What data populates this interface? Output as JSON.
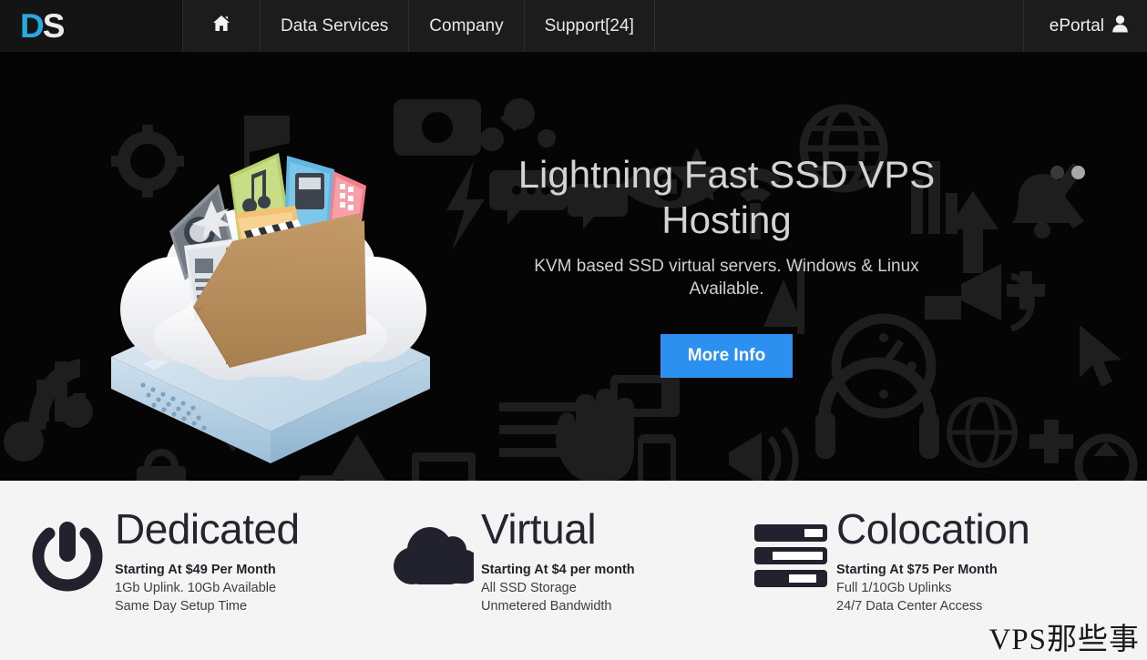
{
  "nav": {
    "logo": {
      "first": "D",
      "second": "S",
      "color_first": "#29a9e1",
      "color_second": "#ececec"
    },
    "home_icon_name": "home-icon",
    "items": [
      {
        "label": "Data Services"
      },
      {
        "label": "Company"
      },
      {
        "label": "Support[24]"
      }
    ],
    "right": {
      "label": "ePortal",
      "icon": "user-icon"
    },
    "background": "#1c1c1c"
  },
  "hero": {
    "title": "Lightning Fast SSD VPS Hosting",
    "subtitle": "KVM based SSD virtual servers. Windows & Linux Available.",
    "button_label": "More Info",
    "button_color": "#2b90f0",
    "background": "#050505",
    "illustration_name": "cloud-folder-server-illustration",
    "carousel": {
      "total": 2,
      "active_index": 1
    }
  },
  "features": {
    "background": "#f4f4f5",
    "items": [
      {
        "icon": "power-icon",
        "title": "Dedicated",
        "price": "Starting At $49 Per Month",
        "line1": "1Gb Uplink. 10Gb Available",
        "line2": "Same Day Setup Time"
      },
      {
        "icon": "cloud-icon",
        "title": "Virtual",
        "price": "Starting At $4 per month",
        "line1": "All SSD Storage",
        "line2": "Unmetered Bandwidth"
      },
      {
        "icon": "server-rack-icon",
        "title": "Colocation",
        "price": "Starting At $75 Per Month",
        "line1": "Full 1/10Gb Uplinks",
        "line2": "24/7 Data Center Access"
      }
    ]
  },
  "watermark": {
    "text": "VPS那些事"
  }
}
